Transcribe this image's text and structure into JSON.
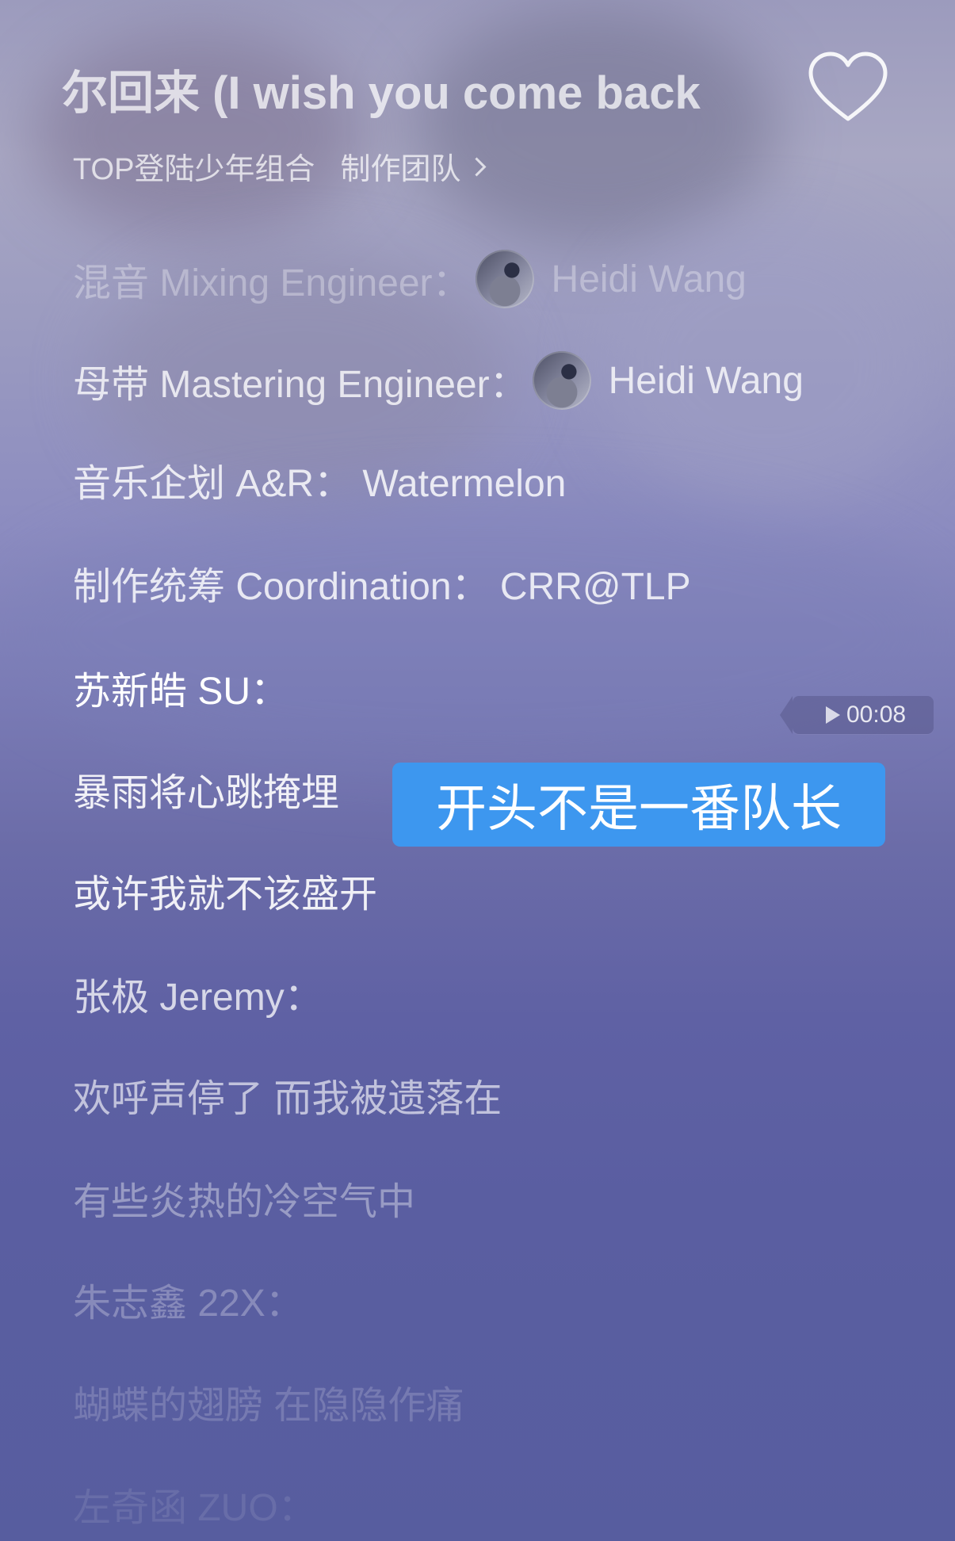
{
  "header": {
    "title": "尔回来 (I wish you come back",
    "artist": "TOP登陆少年组合",
    "credits_link": "制作团队"
  },
  "lyrics": [
    {
      "label": "混音 Mixing Engineer：",
      "name": "Heidi Wang"
    },
    {
      "label": "母带 Mastering Engineer：",
      "name": "Heidi Wang"
    },
    {
      "text": "音乐企划 A&R：  Watermelon"
    },
    {
      "text": "制作统筹 Coordination：  CRR@TLP"
    },
    {
      "text": "苏新皓 SU："
    },
    {
      "text": "暴雨将心跳掩埋"
    },
    {
      "text": "或许我就不该盛开"
    },
    {
      "text": "张极 Jeremy："
    },
    {
      "text": "欢呼声停了 而我被遗落在"
    },
    {
      "text": "有些炎热的冷空气中"
    },
    {
      "text": "朱志鑫 22X："
    },
    {
      "text": "蝴蝶的翅膀 在隐隐作痛"
    },
    {
      "text": "左奇函 ZUO："
    }
  ],
  "playhead": {
    "time": "00:08"
  },
  "annotation": {
    "text": "开头不是一番队长"
  },
  "icons": {
    "favorite": "heart-outline-icon",
    "credits_arrow": "chevron-right-icon",
    "play": "play-icon"
  },
  "colors": {
    "annotation_bg": "#3d97ef"
  }
}
